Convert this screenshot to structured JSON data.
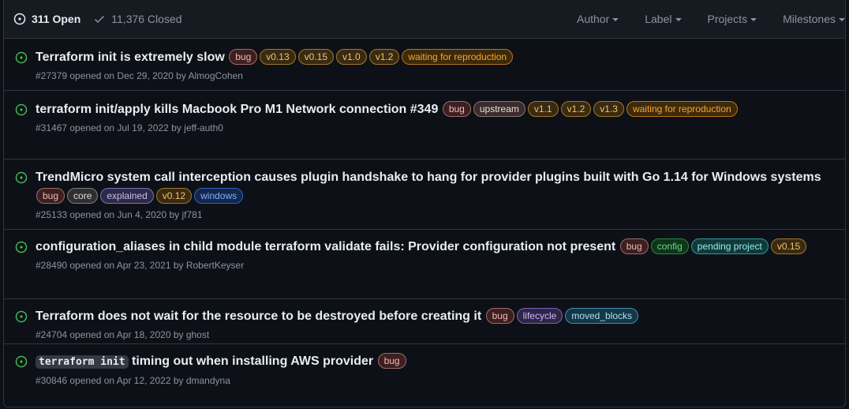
{
  "header": {
    "open_label": "311 Open",
    "closed_label": "11,376 Closed",
    "filters": [
      "Author",
      "Label",
      "Projects",
      "Milestones"
    ]
  },
  "label_colors": {
    "bug": {
      "bg": "#3d1f1f",
      "border": "#9e6a6a",
      "fg": "#f0b8b8"
    },
    "v0.13": {
      "bg": "#3a2a10",
      "border": "#a0782c",
      "fg": "#f0c374"
    },
    "v0.15": {
      "bg": "#3a2a10",
      "border": "#a0782c",
      "fg": "#f0c374"
    },
    "v1.0": {
      "bg": "#3a2a10",
      "border": "#a0782c",
      "fg": "#f0c374"
    },
    "v1.1": {
      "bg": "#3a2a10",
      "border": "#a0782c",
      "fg": "#f0c374"
    },
    "v1.2": {
      "bg": "#3a2a10",
      "border": "#a0782c",
      "fg": "#f0c374"
    },
    "v1.3": {
      "bg": "#3a2a10",
      "border": "#a0782c",
      "fg": "#f0c374"
    },
    "v0.12": {
      "bg": "#3a2a10",
      "border": "#a0782c",
      "fg": "#f0c374"
    },
    "waiting for reproduction": {
      "bg": "#3d2a08",
      "border": "#b9711e",
      "fg": "#f5a43c"
    },
    "upstream": {
      "bg": "#3a2c2c",
      "border": "#8a7474",
      "fg": "#f0dcdc"
    },
    "core": {
      "bg": "#303030",
      "border": "#7c7c7c",
      "fg": "#dcdcdc"
    },
    "explained": {
      "bg": "#2e2a45",
      "border": "#7a6fc0",
      "fg": "#c6bdf5"
    },
    "windows": {
      "bg": "#14264a",
      "border": "#2e63c0",
      "fg": "#7db0ff"
    },
    "config": {
      "bg": "#10331a",
      "border": "#2c8a3f",
      "fg": "#5fe07a"
    },
    "pending project": {
      "bg": "#12393a",
      "border": "#2b9a9a",
      "fg": "#8ff0ee"
    },
    "lifecycle": {
      "bg": "#2f2545",
      "border": "#7a5fc0",
      "fg": "#cdb8ff"
    },
    "moved_blocks": {
      "bg": "#163645",
      "border": "#3a8fb0",
      "fg": "#a6e2f7"
    }
  },
  "issues": [
    {
      "title": "Terraform init is extremely slow",
      "labels": [
        "bug",
        "v0.13",
        "v0.15",
        "v1.0",
        "v1.2",
        "waiting for reproduction"
      ],
      "meta": "#27379 opened on Dec 29, 2020 by AlmogCohen"
    },
    {
      "title": "terraform init/apply kills Macbook Pro M1 Network connection #349",
      "labels": [
        "bug",
        "upstream",
        "v1.1",
        "v1.2",
        "v1.3",
        "waiting for reproduction"
      ],
      "meta": "#31467 opened on Jul 19, 2022 by jeff-auth0"
    },
    {
      "title": "TrendMicro system call interception causes plugin handshake to hang for provider plugins built with Go 1.14 for Windows systems",
      "labels": [
        "bug",
        "core",
        "explained",
        "v0.12",
        "windows"
      ],
      "meta": "#25133 opened on Jun 4, 2020 by jf781"
    },
    {
      "title": "configuration_aliases in child module terraform validate fails: Provider configuration not present",
      "labels": [
        "bug",
        "config",
        "pending project",
        "v0.15"
      ],
      "meta": "#28490 opened on Apr 23, 2021 by RobertKeyser"
    },
    {
      "title": "Terraform does not wait for the resource to be destroyed before creating it",
      "labels": [
        "bug",
        "lifecycle",
        "moved_blocks"
      ],
      "meta": "#24704 opened on Apr 18, 2020 by ghost"
    },
    {
      "title_code": "terraform init",
      "title": "timing out when installing AWS provider",
      "labels": [
        "bug"
      ],
      "meta": "#30846 opened on Apr 12, 2022 by dmandyna"
    }
  ]
}
